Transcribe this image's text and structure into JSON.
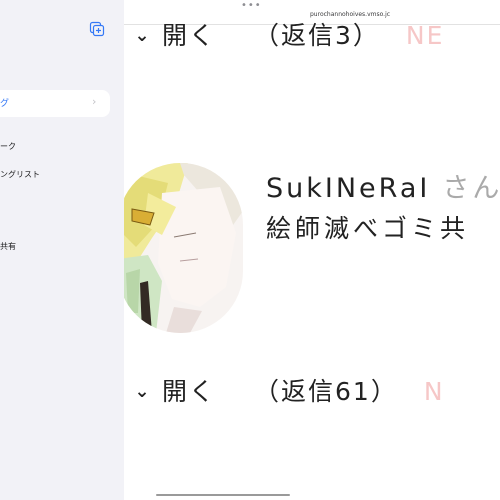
{
  "sidebar": {
    "add_tab_icon": "add-tab-icon",
    "selected_item": {
      "label": "グ",
      "chevron": "›"
    },
    "items": [
      {
        "label": "ーク"
      },
      {
        "label": "ングリスト"
      },
      {
        "label": "共有"
      }
    ]
  },
  "browser": {
    "dots": "•••",
    "url": "purochannohoives.vmso.jc"
  },
  "thread": {
    "expand_top": {
      "chevron": "⌄",
      "label": "開く",
      "reply": "（返信3）",
      "badge": "NE"
    },
    "expand_bottom": {
      "chevron": "⌄",
      "label": "開く",
      "reply": "（返信61）",
      "badge": "N"
    },
    "post": {
      "user": "SukINeRaI",
      "honorific": "さん",
      "comment": "絵師滅べゴミ共"
    }
  },
  "colors": {
    "sidebar_bg": "#f2f2f7",
    "accent": "#3478f6",
    "new_badge": "#f6c7c7"
  }
}
